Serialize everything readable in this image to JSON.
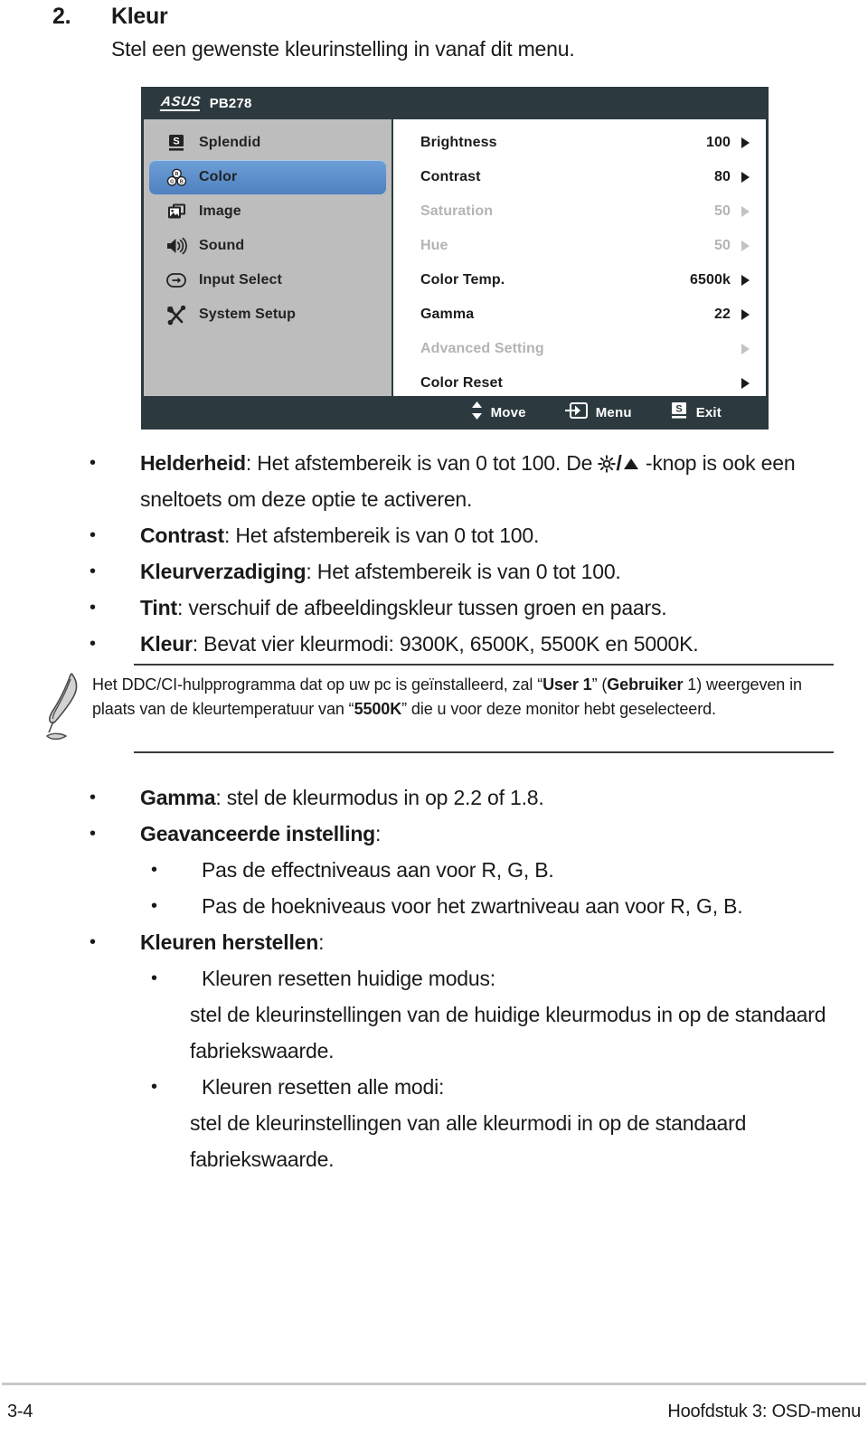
{
  "heading": {
    "number": "2.",
    "title": "Kleur",
    "subtitle": "Stel een gewenste kleurinstelling in vanaf dit menu."
  },
  "osd": {
    "brand": "/ISUS",
    "model": "PB278",
    "sidebar": [
      {
        "label": "Splendid",
        "icon": "splendid-icon",
        "selected": false
      },
      {
        "label": "Color",
        "icon": "color-rgb-icon",
        "selected": true
      },
      {
        "label": "Image",
        "icon": "image-icon",
        "selected": false
      },
      {
        "label": "Sound",
        "icon": "sound-speaker-icon",
        "selected": false
      },
      {
        "label": "Input Select",
        "icon": "input-select-icon",
        "selected": false
      },
      {
        "label": "System Setup",
        "icon": "system-setup-tools-icon",
        "selected": false
      }
    ],
    "options": [
      {
        "label": "Brightness",
        "value": "100",
        "dim": false
      },
      {
        "label": "Contrast",
        "value": "80",
        "dim": false
      },
      {
        "label": "Saturation",
        "value": "50",
        "dim": true
      },
      {
        "label": "Hue",
        "value": "50",
        "dim": true
      },
      {
        "label": "Color Temp.",
        "value": "6500k",
        "dim": false
      },
      {
        "label": "Gamma",
        "value": "22",
        "dim": false
      },
      {
        "label": "Advanced Setting",
        "value": "",
        "dim": true
      },
      {
        "label": "Color Reset",
        "value": "",
        "dim": false
      }
    ],
    "footer": [
      {
        "label": "Move",
        "icon": "up-down-arrows-icon"
      },
      {
        "label": "Menu",
        "icon": "menu-enter-icon"
      },
      {
        "label": "Exit",
        "icon": "splendid-s-icon"
      }
    ],
    "colors": {
      "chrome": "#2c3a3f",
      "sidebar": "#bdbdbd",
      "highlight": "#5f91cd",
      "panel": "#ffffff",
      "dim_text": "#b4b4b4"
    }
  },
  "bullets_top": [
    {
      "term": "Helderheid",
      "rest_before_icon": ": Het afstembereik is van 0 tot 100. De ",
      "icon_sun": "brightness-sun-icon",
      "icon_sep": "/",
      "icon_tri": "up-triangle-icon",
      "rest_after_icon": " -knop is ook een sneltoets om deze optie te activeren."
    },
    {
      "term": "Contrast",
      "rest": ": Het afstembereik is van 0 tot 100."
    },
    {
      "term": "Kleurverzadiging",
      "rest": ": Het afstembereik is van 0 tot 100."
    },
    {
      "term": "Tint",
      "rest": ": verschuif de afbeeldingskleur tussen groen en paars."
    },
    {
      "term": "Kleur",
      "rest": ": Bevat vier kleurmodi: 9300K, 6500K, 5500K en 5000K."
    }
  ],
  "note": {
    "icon": "feather-pen-icon",
    "p1_a": "Het DDC/CI-hulpprogramma dat op uw pc is geïnstalleerd, zal “",
    "p1_b": "User 1",
    "p1_c": "” (",
    "p1_d": "Gebruiker",
    "p1_e": " 1) weergeven in plaats van de kleurtemperatuur van “",
    "p1_f": "5500K",
    "p1_g": "” die u voor deze monitor hebt geselecteerd."
  },
  "bullets_bottom": [
    {
      "level": 1,
      "term": "Gamma",
      "rest": ": stel de kleurmodus in op 2.2 of 1.8."
    },
    {
      "level": 1,
      "term": "Geavanceerde instelling",
      "rest": ":"
    },
    {
      "level": 2,
      "term": "",
      "rest": "Pas de effectniveaus aan voor R, G, B."
    },
    {
      "level": 2,
      "term": "",
      "rest": "Pas de hoekniveaus voor het zwartniveau aan voor R, G, B."
    },
    {
      "level": 1,
      "term": "Kleuren herstellen",
      "rest": ":"
    },
    {
      "level": 2,
      "term": "",
      "rest": "Kleuren resetten huidige modus:"
    },
    {
      "level": 0,
      "term": "",
      "rest": "stel de kleurinstellingen van de huidige kleurmodus in op de standaard fabriekswaarde."
    },
    {
      "level": 2,
      "term": "",
      "rest": "Kleuren resetten alle modi:"
    },
    {
      "level": 0,
      "term": "",
      "rest": "stel de kleurinstellingen van alle kleurmodi in op de standaard fabriekswaarde."
    }
  ],
  "page_footer": {
    "page_number": "3-4",
    "chapter": "Hoofdstuk 3: OSD-menu"
  }
}
